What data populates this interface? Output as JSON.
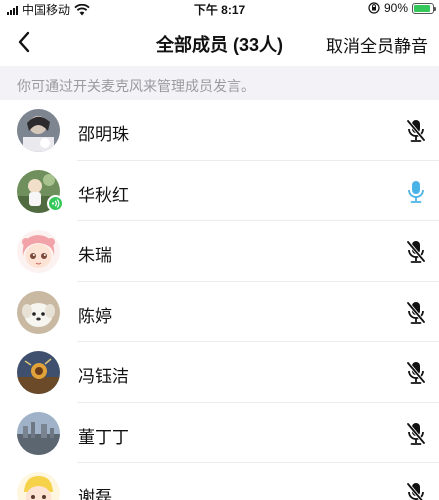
{
  "status_bar": {
    "carrier": "中国移动",
    "time": "下午 8:17",
    "battery_percent_text": "90%",
    "battery_level": 0.9
  },
  "nav": {
    "back_icon": "chevron-left-icon",
    "title": "全部成员 (33人)",
    "action_label": "取消全员静音"
  },
  "hint": {
    "text": "你可通过开关麦克风来管理成员发言。"
  },
  "members": [
    {
      "name": "邵明珠",
      "mic": "muted"
    },
    {
      "name": "华秋红",
      "mic": "active"
    },
    {
      "name": "朱瑞",
      "mic": "muted"
    },
    {
      "name": "陈婷",
      "mic": "muted"
    },
    {
      "name": "冯钰洁",
      "mic": "muted"
    },
    {
      "name": "董丁丁",
      "mic": "muted"
    },
    {
      "name": "谢磊",
      "mic": "muted"
    }
  ],
  "colors": {
    "mic_active": "#4ab3e8",
    "mic_muted": "#111111",
    "hint_bg": "#f2f2f7",
    "speaking_badge": "#34c759"
  }
}
